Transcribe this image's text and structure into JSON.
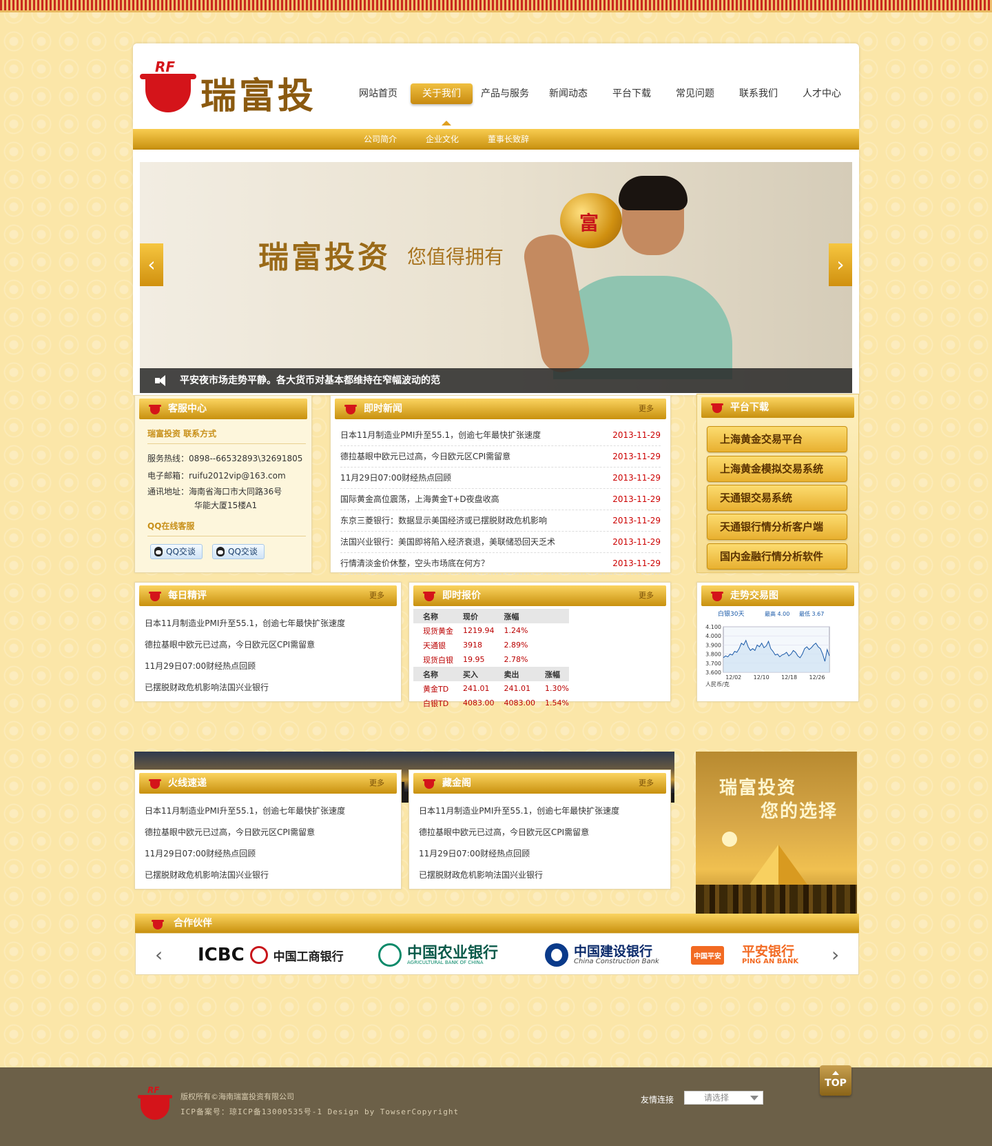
{
  "brand": {
    "logo_mark": "RF",
    "name": "瑞富投资"
  },
  "nav": [
    "网站首页",
    "关于我们",
    "产品与服务",
    "新闻动态",
    "平台下载",
    "常见问题",
    "联系我们",
    "人才中心"
  ],
  "subnav": [
    "公司简介",
    "企业文化",
    "董事长致辞"
  ],
  "banner": {
    "headline": "瑞富投资",
    "tagline": "您值得拥有",
    "pig_char": "富",
    "ticker": "平安夜市场走势平静。各大货币对基本都维持在窄幅波动的范",
    "prev": "‹",
    "next": "›"
  },
  "service": {
    "title": "客服中心",
    "section1": "瑞富投资  联系方式",
    "hotline": "服务热线：0898--66532893\\32691805",
    "email": "电子邮箱：ruifu2012vip@163.com",
    "address1": "通讯地址：海南省海口市大同路36号",
    "address2": "华能大厦15楼A1",
    "section2": "QQ在线客服",
    "qq1": "QQ交谈",
    "qq2": "QQ交谈"
  },
  "news": {
    "title": "即时新闻",
    "more": "更多",
    "items": [
      {
        "t": "日本11月制造业PMI升至55.1，创逾七年最快扩张速度",
        "d": "2013-11-29"
      },
      {
        "t": "德拉基眼中欧元已过高，今日欧元区CPI需留意",
        "d": "2013-11-29"
      },
      {
        "t": "11月29日07:00财经热点回顾",
        "d": "2013-11-29"
      },
      {
        "t": "国际黄金高位震荡，上海黄金T+D夜盘收高",
        "d": "2013-11-29"
      },
      {
        "t": "东京三菱银行：数据显示美国经济或已摆脱财政危机影响",
        "d": "2013-11-29"
      },
      {
        "t": "法国兴业银行：美国即将陷入经济衰退，美联储恐回天乏术",
        "d": "2013-11-29"
      },
      {
        "t": "行情清淡金价休整，空头市场底在何方？",
        "d": "2013-11-29"
      }
    ]
  },
  "platform": {
    "title": "平台下载",
    "buttons": [
      "上海黄金交易平台",
      "上海黄金模拟交易系统",
      "天通银交易系统",
      "天通银行情分析客户端",
      "国内金融行情分析软件"
    ]
  },
  "daily": {
    "title": "每日精评",
    "more": "更多",
    "items": [
      "日本11月制造业PMI升至55.1，创逾七年最快扩张速度",
      "德拉基眼中欧元已过高，今日欧元区CPI需留意",
      "11月29日07:00财经热点回顾",
      "已摆脱财政危机影响法国兴业银行"
    ]
  },
  "quotes": {
    "title": "即时报价",
    "more": "更多",
    "h1": [
      "名称",
      "现价",
      "涨幅"
    ],
    "rows1": [
      [
        "现货黄金",
        "1219.94",
        "1.24%"
      ],
      [
        "天通银",
        "3918",
        "2.89%"
      ],
      [
        "现货白银",
        "19.95",
        "2.78%"
      ]
    ],
    "h2": [
      "名称",
      "买入",
      "卖出",
      "涨幅"
    ],
    "rows2": [
      [
        "黄金TD",
        "241.01",
        "241.01",
        "1.30%"
      ],
      [
        "白银TD",
        "4083.00",
        "4083.00",
        "1.54%"
      ]
    ]
  },
  "trend": {
    "title": "走势交易图"
  },
  "chart_data": {
    "type": "line",
    "title": "白银30天",
    "high_label": "最高 4.00",
    "low_label": "最低 3.67",
    "ylabel": "人民币/克",
    "yticks": [
      "4.100",
      "4.000",
      "3.900",
      "3.800",
      "3.700",
      "3.600"
    ],
    "ylim": [
      3.6,
      4.1
    ],
    "xticks": [
      "12/02",
      "12/10",
      "12/18",
      "12/26"
    ],
    "series": [
      {
        "values": [
          3.76,
          3.78,
          3.77,
          3.8,
          3.79,
          3.83,
          3.82,
          3.86,
          3.92,
          3.9,
          3.95,
          3.88,
          3.84,
          3.86,
          3.84,
          3.9,
          3.88,
          3.92,
          3.87,
          3.89,
          3.94,
          3.86,
          3.83,
          3.79,
          3.8,
          3.77,
          3.79,
          3.8,
          3.82,
          3.78,
          3.8,
          3.84,
          3.82,
          3.78,
          3.76,
          3.8,
          3.86,
          3.88,
          3.85,
          3.87,
          3.9,
          3.92,
          3.88,
          3.86,
          3.8,
          3.72,
          3.85,
          3.78
        ]
      }
    ]
  },
  "fire": {
    "title": "火线速递",
    "more": "更多",
    "items": [
      "日本11月制造业PMI升至55.1，创逾七年最快扩张速度",
      "德拉基眼中欧元已过高，今日欧元区CPI需留意",
      "11月29日07:00财经热点回顾",
      "已摆脱财政危机影响法国兴业银行"
    ]
  },
  "gold": {
    "title": "藏金阁",
    "more": "更多",
    "items": [
      "日本11月制造业PMI升至55.1，创逾七年最快扩张速度",
      "德拉基眼中欧元已过高，今日欧元区CPI需留意",
      "11月29日07:00财经热点回顾",
      "已摆脱财政危机影响法国兴业银行"
    ]
  },
  "side_ad": {
    "line1": "瑞富投资",
    "line2": "您的选择"
  },
  "partners": {
    "title": "合作伙伴",
    "prev": "‹",
    "next": "›",
    "logos": [
      {
        "en": "ICBC",
        "cn": "中国工商银行"
      },
      {
        "cn": "中国农业银行",
        "en": "AGRICULTURAL BANK OF CHINA"
      },
      {
        "cn": "中国建设银行",
        "en": "China Construction Bank"
      },
      {
        "tag": "中国平安",
        "cn": "平安银行",
        "en": "PING AN BANK"
      }
    ]
  },
  "footer": {
    "copyright": "版权所有©海南瑞富投资有限公司",
    "icp": "ICP备案号：琼ICP备13000535号-1 Design by TowserCopyright",
    "links_label": "友情连接",
    "select": "请选择",
    "top": "TOP"
  }
}
